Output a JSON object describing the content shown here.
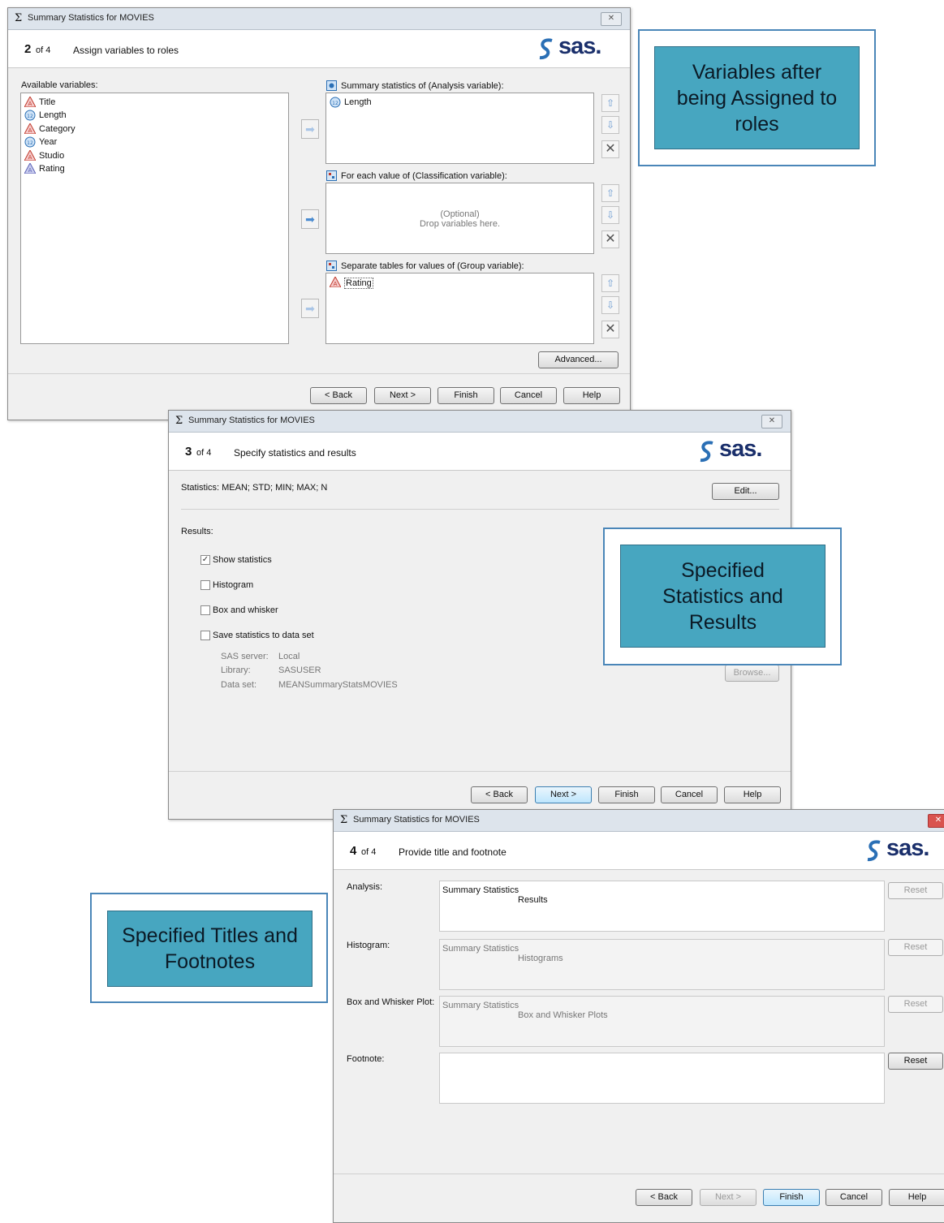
{
  "dialog1": {
    "title": "Summary Statistics for MOVIES",
    "step_num": "2",
    "step_of": "of 4",
    "step_title": "Assign variables to roles",
    "logo": "sas.",
    "available_label": "Available variables:",
    "variables": [
      {
        "name": "Title",
        "icon": "character-variable-icon"
      },
      {
        "name": "Length",
        "icon": "numeric-variable-icon"
      },
      {
        "name": "Category",
        "icon": "character-variable-icon"
      },
      {
        "name": "Year",
        "icon": "numeric-variable-icon"
      },
      {
        "name": "Studio",
        "icon": "character-variable-icon"
      },
      {
        "name": "Rating",
        "icon": "character-variable-icon"
      }
    ],
    "role_analysis_label": "Summary statistics of (Analysis variable):",
    "role_analysis_item": "Length",
    "role_class_label": "For each value of (Classification variable):",
    "role_class_placeholder_1": "(Optional)",
    "role_class_placeholder_2": "Drop variables here.",
    "role_group_label": "Separate tables for values of (Group variable):",
    "role_group_item": "Rating",
    "advanced": "Advanced...",
    "back": "< Back",
    "next": "Next >",
    "finish": "Finish",
    "cancel": "Cancel",
    "help": "Help"
  },
  "dialog2": {
    "title": "Summary Statistics for MOVIES",
    "step_num": "3",
    "step_of": "of 4",
    "step_title": "Specify statistics and results",
    "logo": "sas.",
    "statistics": "Statistics: MEAN; STD; MIN; MAX; N",
    "edit": "Edit...",
    "results_label": "Results:",
    "show_statistics": "Show statistics",
    "show_statistics_checked": true,
    "histogram": "Histogram",
    "box_whisker": "Box and whisker",
    "save_stats": "Save statistics to data set",
    "server_label": "SAS server:",
    "server_value": "Local",
    "library_label": "Library:",
    "library_value": "SASUSER",
    "dataset_label": "Data set:",
    "dataset_value": "MEANSummaryStatsMOVIES",
    "browse": "Browse...",
    "back": "< Back",
    "next": "Next >",
    "finish": "Finish",
    "cancel": "Cancel",
    "help": "Help"
  },
  "dialog3": {
    "title": "Summary Statistics for MOVIES",
    "step_num": "4",
    "step_of": "of 4",
    "step_title": "Provide title and footnote",
    "logo": "sas.",
    "analysis_label": "Analysis:",
    "analysis_line1": "Summary Statistics",
    "analysis_line2": "Results",
    "histogram_label": "Histogram:",
    "histogram_line1": "Summary Statistics",
    "histogram_line2": "Histograms",
    "box_label": "Box and Whisker Plot:",
    "box_line1": "Summary Statistics",
    "box_line2": "Box and Whisker Plots",
    "footnote_label": "Footnote:",
    "reset": "Reset",
    "back": "< Back",
    "next": "Next >",
    "finish": "Finish",
    "cancel": "Cancel",
    "help": "Help"
  },
  "callouts": {
    "c1": "Variables after being Assigned to roles",
    "c2": "Specified Statistics and Results",
    "c3": "Specified Titles and Footnotes"
  },
  "colors": {
    "callout_fill": "#47a6c0",
    "callout_border": "#4a86b8",
    "sas_blue": "#1a2f6b"
  }
}
